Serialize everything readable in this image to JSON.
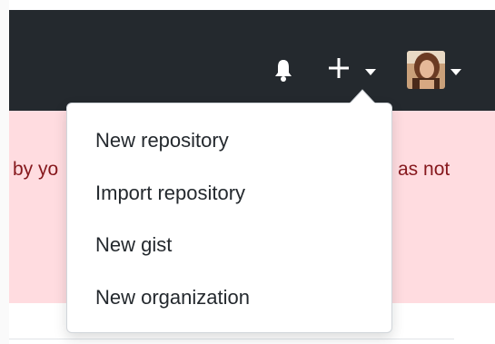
{
  "header": {
    "notifications_icon": "bell-icon",
    "create_icon": "plus-icon",
    "avatar_icon": "user-avatar"
  },
  "banner": {
    "text_left": "by yo",
    "text_right": "as not"
  },
  "create_menu": {
    "items": [
      {
        "label": "New repository"
      },
      {
        "label": "Import repository"
      },
      {
        "label": "New gist"
      },
      {
        "label": "New organization"
      }
    ]
  },
  "colors": {
    "header_bg": "#24292e",
    "banner_bg": "#ffdce0",
    "banner_text": "#86181d",
    "menu_text": "#24292e",
    "icon": "#ffffff"
  }
}
